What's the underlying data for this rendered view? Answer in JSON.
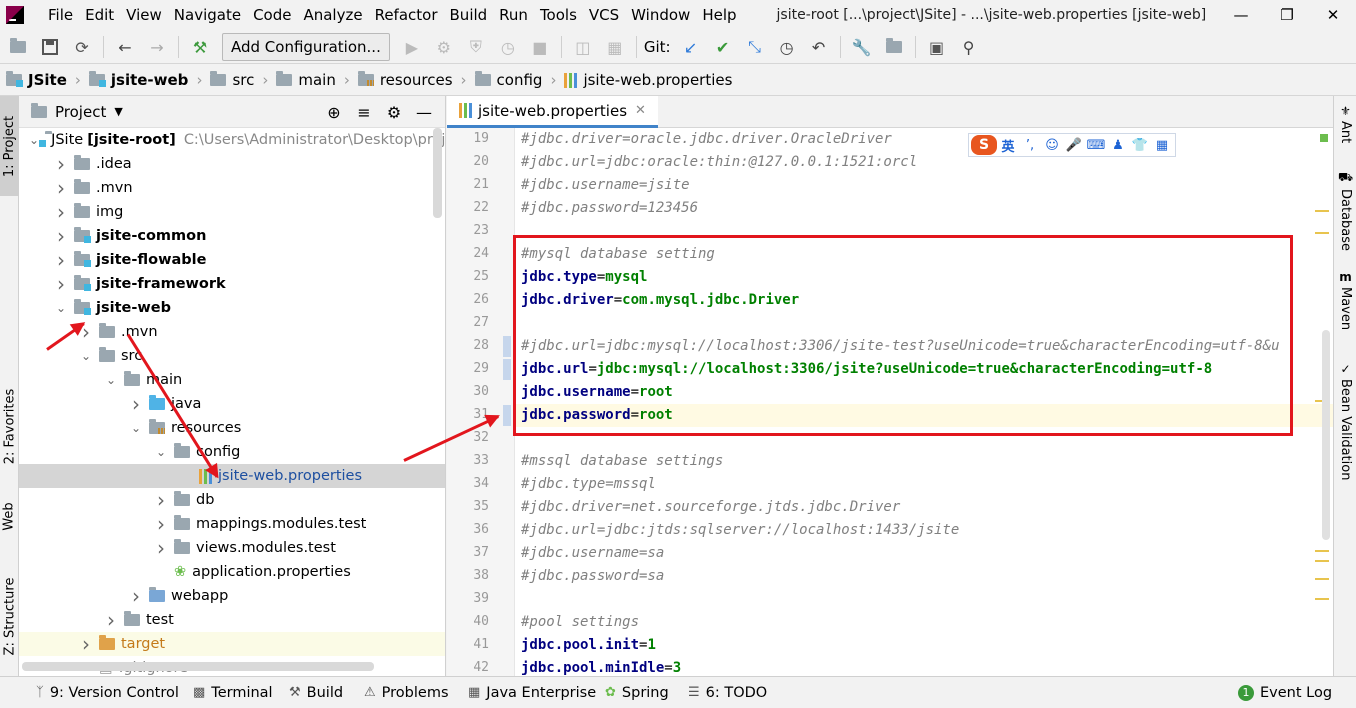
{
  "window": {
    "title": "jsite-root [...\\project\\JSite] - ...\\jsite-web.properties [jsite-web]",
    "menus": [
      "File",
      "Edit",
      "View",
      "Navigate",
      "Code",
      "Analyze",
      "Refactor",
      "Build",
      "Run",
      "Tools",
      "VCS",
      "Window",
      "Help"
    ]
  },
  "toolbar": {
    "add_configuration": "Add Configuration...",
    "git_label": "Git:"
  },
  "breadcrumb": [
    "JSite",
    "jsite-web",
    "src",
    "main",
    "resources",
    "config",
    "jsite-web.properties"
  ],
  "left_strip": {
    "project_tab": "1: Project",
    "favorites_tab": "2: Favorites",
    "web_tab": "Web",
    "structure_tab": "Z: Structure"
  },
  "project_panel": {
    "title": "Project",
    "tree": [
      {
        "label": "JSite",
        "suffix": "[jsite-root]",
        "path": "C:\\Users\\Administrator\\Desktop\\project\\JSite",
        "expanded": true
      },
      {
        "label": ".idea"
      },
      {
        "label": ".mvn"
      },
      {
        "label": "img"
      },
      {
        "label": "jsite-common"
      },
      {
        "label": "jsite-flowable"
      },
      {
        "label": "jsite-framework"
      },
      {
        "label": "jsite-web"
      },
      {
        "label": ".mvn"
      },
      {
        "label": "src"
      },
      {
        "label": "main"
      },
      {
        "label": "java"
      },
      {
        "label": "resources"
      },
      {
        "label": "config"
      },
      {
        "label": "jsite-web.properties"
      },
      {
        "label": "db"
      },
      {
        "label": "mappings.modules.test"
      },
      {
        "label": "views.modules.test"
      },
      {
        "label": "application.properties"
      },
      {
        "label": "webapp"
      },
      {
        "label": "test"
      },
      {
        "label": "target"
      },
      {
        "label": ".gitignore"
      }
    ]
  },
  "editor": {
    "tab_label": "jsite-web.properties",
    "lines": [
      {
        "n": "19",
        "parts": [
          {
            "t": "#jdbc.driver=oracle.jdbc.driver.OracleDriver",
            "c": "cm"
          }
        ]
      },
      {
        "n": "20",
        "parts": [
          {
            "t": "#jdbc.url=jdbc:oracle:thin:@127.0.0.1:1521:orcl",
            "c": "cm"
          }
        ]
      },
      {
        "n": "21",
        "parts": [
          {
            "t": "#jdbc.username=jsite",
            "c": "cm"
          }
        ]
      },
      {
        "n": "22",
        "parts": [
          {
            "t": "#jdbc.password=123456",
            "c": "cm"
          }
        ]
      },
      {
        "n": "23",
        "parts": []
      },
      {
        "n": "24",
        "parts": [
          {
            "t": "#mysql database setting",
            "c": "cm"
          }
        ]
      },
      {
        "n": "25",
        "parts": [
          {
            "t": "jdbc.type",
            "c": "k"
          },
          {
            "t": "=",
            "c": ""
          },
          {
            "t": "mysql",
            "c": "v"
          }
        ]
      },
      {
        "n": "26",
        "parts": [
          {
            "t": "jdbc.driver",
            "c": "k"
          },
          {
            "t": "=",
            "c": ""
          },
          {
            "t": "com.mysql.jdbc.Driver",
            "c": "v"
          }
        ]
      },
      {
        "n": "27",
        "parts": []
      },
      {
        "n": "28",
        "parts": [
          {
            "t": "#jdbc.url=jdbc:mysql://localhost:3306/jsite-test?useUnicode=true&characterEncoding=utf-8&u",
            "c": "cm"
          }
        ]
      },
      {
        "n": "29",
        "parts": [
          {
            "t": "jdbc.url",
            "c": "k"
          },
          {
            "t": "=",
            "c": ""
          },
          {
            "t": "jdbc:mysql://localhost:3306/jsite?useUnicode=true&characterEncoding=utf-8",
            "c": "v"
          }
        ]
      },
      {
        "n": "30",
        "parts": [
          {
            "t": "jdbc.username",
            "c": "k"
          },
          {
            "t": "=",
            "c": ""
          },
          {
            "t": "root",
            "c": "v"
          }
        ]
      },
      {
        "n": "31",
        "parts": [
          {
            "t": "jdbc.password",
            "c": "k"
          },
          {
            "t": "=",
            "c": ""
          },
          {
            "t": "root",
            "c": "v"
          }
        ]
      },
      {
        "n": "32",
        "parts": []
      },
      {
        "n": "33",
        "parts": [
          {
            "t": "#mssql database settings",
            "c": "cm"
          }
        ]
      },
      {
        "n": "34",
        "parts": [
          {
            "t": "#jdbc.type=mssql",
            "c": "cm"
          }
        ]
      },
      {
        "n": "35",
        "parts": [
          {
            "t": "#jdbc.driver=net.sourceforge.jtds.jdbc.Driver",
            "c": "cm"
          }
        ]
      },
      {
        "n": "36",
        "parts": [
          {
            "t": "#jdbc.url=jdbc:jtds:sqlserver://localhost:1433/jsite",
            "c": "cm"
          }
        ]
      },
      {
        "n": "37",
        "parts": [
          {
            "t": "#jdbc.username=sa",
            "c": "cm"
          }
        ]
      },
      {
        "n": "38",
        "parts": [
          {
            "t": "#jdbc.password=sa",
            "c": "cm"
          }
        ]
      },
      {
        "n": "39",
        "parts": []
      },
      {
        "n": "40",
        "parts": [
          {
            "t": "#pool settings",
            "c": "cm"
          }
        ]
      },
      {
        "n": "41",
        "parts": [
          {
            "t": "jdbc.pool.init",
            "c": "k"
          },
          {
            "t": "=",
            "c": ""
          },
          {
            "t": "1",
            "c": "v"
          }
        ]
      },
      {
        "n": "42",
        "parts": [
          {
            "t": "jdbc.pool.minIdle",
            "c": "k"
          },
          {
            "t": "=",
            "c": ""
          },
          {
            "t": "3",
            "c": "v"
          }
        ]
      }
    ]
  },
  "ime_bar": {
    "logo": "S",
    "lang": "英"
  },
  "right_strip": [
    "Ant",
    "Database",
    "Maven",
    "Bean Validation"
  ],
  "statusbar": {
    "version_control": "9: Version Control",
    "terminal": "Terminal",
    "build": "Build",
    "problems": "Problems",
    "java_enterprise": "Java Enterprise",
    "spring": "Spring",
    "todo": "6: TODO",
    "event_log": "Event Log"
  },
  "colors": {
    "highlight_box": "#e2161d",
    "accent": "#4083c9"
  }
}
